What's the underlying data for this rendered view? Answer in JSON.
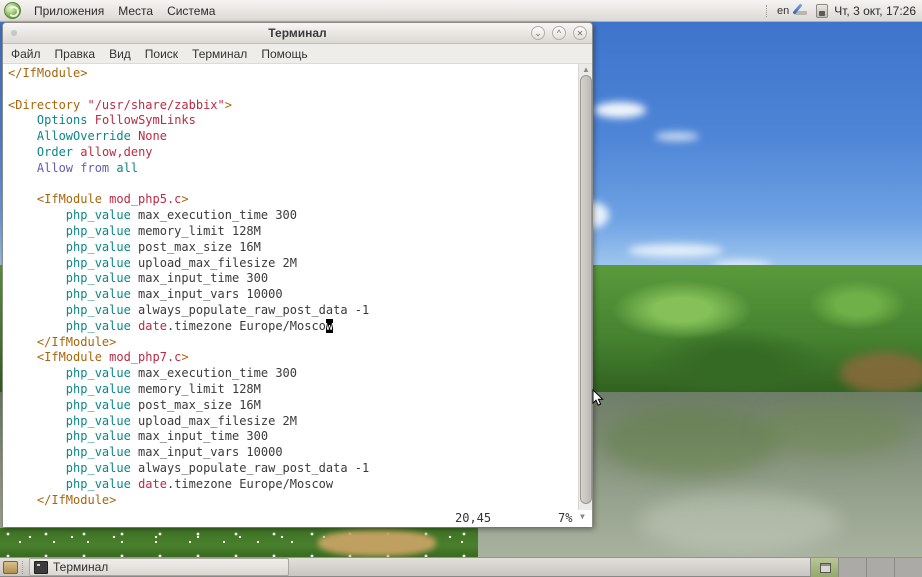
{
  "top_panel": {
    "menus": [
      {
        "label": "Приложения"
      },
      {
        "label": "Места"
      },
      {
        "label": "Система"
      }
    ],
    "keyboard_layout": "en",
    "clock": "Чт, 3 окт, 17:26",
    "tray_icons": [
      "tablet-pen-icon",
      "clipboard-device-icon"
    ]
  },
  "terminal_window": {
    "title": "Терминал",
    "window_buttons": {
      "minimize": "⌄",
      "maximize": "^",
      "close": "✕"
    },
    "menu_items": [
      "Файл",
      "Правка",
      "Вид",
      "Поиск",
      "Терминал",
      "Помощь"
    ],
    "status": {
      "ruler": "20,45",
      "percent": "7%"
    },
    "palette": {
      "tag": "#a8650a",
      "prop": "#0b8689",
      "val": "#bb2a43",
      "spc": "#5f5faf",
      "txt": "#3a3a3a",
      "cursor_bg": "#000000",
      "cursor_fg": "#ffffff"
    },
    "lines": [
      [
        {
          "t": "</IfModule>",
          "c": "tag"
        }
      ],
      [
        {
          "t": "",
          "c": "txt"
        }
      ],
      [
        {
          "t": "<Directory ",
          "c": "tag"
        },
        {
          "t": "\"/usr/share/zabbix\"",
          "c": "val"
        },
        {
          "t": ">",
          "c": "tag"
        }
      ],
      [
        {
          "t": "    ",
          "c": "txt"
        },
        {
          "t": "Options",
          "c": "prop"
        },
        {
          "t": " ",
          "c": "txt"
        },
        {
          "t": "FollowSymLinks",
          "c": "val"
        }
      ],
      [
        {
          "t": "    ",
          "c": "txt"
        },
        {
          "t": "AllowOverride",
          "c": "prop"
        },
        {
          "t": " ",
          "c": "txt"
        },
        {
          "t": "None",
          "c": "val"
        }
      ],
      [
        {
          "t": "    ",
          "c": "txt"
        },
        {
          "t": "Order",
          "c": "prop"
        },
        {
          "t": " ",
          "c": "txt"
        },
        {
          "t": "allow,deny",
          "c": "val"
        }
      ],
      [
        {
          "t": "    ",
          "c": "txt"
        },
        {
          "t": "Allow from ",
          "c": "spc"
        },
        {
          "t": "all",
          "c": "prop"
        }
      ],
      [
        {
          "t": "",
          "c": "txt"
        }
      ],
      [
        {
          "t": "    ",
          "c": "txt"
        },
        {
          "t": "<IfModule ",
          "c": "tag"
        },
        {
          "t": "mod_php5.c",
          "c": "val"
        },
        {
          "t": ">",
          "c": "tag"
        }
      ],
      [
        {
          "t": "        ",
          "c": "txt"
        },
        {
          "t": "php_value",
          "c": "prop"
        },
        {
          "t": " max_execution_time 300",
          "c": "txt"
        }
      ],
      [
        {
          "t": "        ",
          "c": "txt"
        },
        {
          "t": "php_value",
          "c": "prop"
        },
        {
          "t": " memory_limit 128M",
          "c": "txt"
        }
      ],
      [
        {
          "t": "        ",
          "c": "txt"
        },
        {
          "t": "php_value",
          "c": "prop"
        },
        {
          "t": " post_max_size 16M",
          "c": "txt"
        }
      ],
      [
        {
          "t": "        ",
          "c": "txt"
        },
        {
          "t": "php_value",
          "c": "prop"
        },
        {
          "t": " upload_max_filesize 2M",
          "c": "txt"
        }
      ],
      [
        {
          "t": "        ",
          "c": "txt"
        },
        {
          "t": "php_value",
          "c": "prop"
        },
        {
          "t": " max_input_time 300",
          "c": "txt"
        }
      ],
      [
        {
          "t": "        ",
          "c": "txt"
        },
        {
          "t": "php_value",
          "c": "prop"
        },
        {
          "t": " max_input_vars 10000",
          "c": "txt"
        }
      ],
      [
        {
          "t": "        ",
          "c": "txt"
        },
        {
          "t": "php_value",
          "c": "prop"
        },
        {
          "t": " always_populate_raw_post_data -1",
          "c": "txt"
        }
      ],
      [
        {
          "t": "        ",
          "c": "txt"
        },
        {
          "t": "php_value",
          "c": "prop"
        },
        {
          "t": " ",
          "c": "txt"
        },
        {
          "t": "date",
          "c": "val"
        },
        {
          "t": ".timezone Europe/Mosco",
          "c": "txt"
        },
        {
          "t": "w",
          "c": "cursor"
        }
      ],
      [
        {
          "t": "    ",
          "c": "txt"
        },
        {
          "t": "</IfModule>",
          "c": "tag"
        }
      ],
      [
        {
          "t": "    ",
          "c": "txt"
        },
        {
          "t": "<IfModule ",
          "c": "tag"
        },
        {
          "t": "mod_php7.c",
          "c": "val"
        },
        {
          "t": ">",
          "c": "tag"
        }
      ],
      [
        {
          "t": "        ",
          "c": "txt"
        },
        {
          "t": "php_value",
          "c": "prop"
        },
        {
          "t": " max_execution_time 300",
          "c": "txt"
        }
      ],
      [
        {
          "t": "        ",
          "c": "txt"
        },
        {
          "t": "php_value",
          "c": "prop"
        },
        {
          "t": " memory_limit 128M",
          "c": "txt"
        }
      ],
      [
        {
          "t": "        ",
          "c": "txt"
        },
        {
          "t": "php_value",
          "c": "prop"
        },
        {
          "t": " post_max_size 16M",
          "c": "txt"
        }
      ],
      [
        {
          "t": "        ",
          "c": "txt"
        },
        {
          "t": "php_value",
          "c": "prop"
        },
        {
          "t": " upload_max_filesize 2M",
          "c": "txt"
        }
      ],
      [
        {
          "t": "        ",
          "c": "txt"
        },
        {
          "t": "php_value",
          "c": "prop"
        },
        {
          "t": " max_input_time 300",
          "c": "txt"
        }
      ],
      [
        {
          "t": "        ",
          "c": "txt"
        },
        {
          "t": "php_value",
          "c": "prop"
        },
        {
          "t": " max_input_vars 10000",
          "c": "txt"
        }
      ],
      [
        {
          "t": "        ",
          "c": "txt"
        },
        {
          "t": "php_value",
          "c": "prop"
        },
        {
          "t": " always_populate_raw_post_data -1",
          "c": "txt"
        }
      ],
      [
        {
          "t": "        ",
          "c": "txt"
        },
        {
          "t": "php_value",
          "c": "prop"
        },
        {
          "t": " ",
          "c": "txt"
        },
        {
          "t": "date",
          "c": "val"
        },
        {
          "t": ".timezone Europe/Moscow",
          "c": "txt"
        }
      ],
      [
        {
          "t": "    ",
          "c": "txt"
        },
        {
          "t": "</IfModule>",
          "c": "tag"
        }
      ]
    ]
  },
  "taskbar": {
    "window_button_label": "Терминал",
    "workspace_count": 4,
    "active_workspace": 1
  }
}
